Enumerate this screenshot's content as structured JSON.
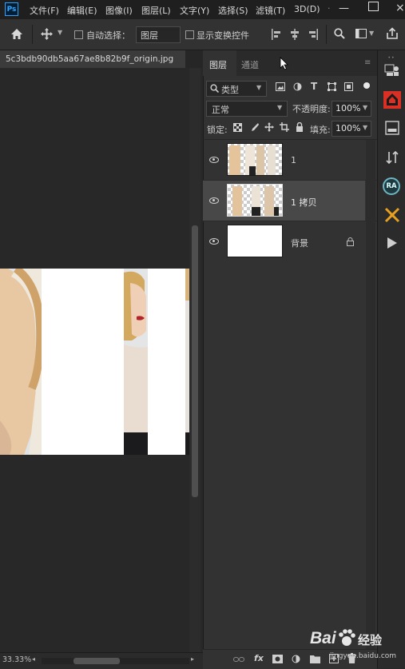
{
  "app_logo": "Ps",
  "menu": [
    "文件(F)",
    "编辑(E)",
    "图像(I)",
    "图层(L)",
    "文字(Y)",
    "选择(S)",
    "滤镜(T)",
    "3D(D)"
  ],
  "options": {
    "auto_select_label": "自动选择：",
    "auto_select_value": "图层",
    "show_transform_label": "显示变换控件"
  },
  "document": {
    "tab_title": "5c3bdb90db5aa67ae8b82b9f_origin.jpg",
    "zoom": "33.33%"
  },
  "layers_panel": {
    "tabs": [
      "图层",
      "通道"
    ],
    "filter_kind": "类型",
    "blend_mode": "正常",
    "opacity_label": "不透明度:",
    "opacity_value": "100%",
    "lock_label": "锁定:",
    "fill_label": "填充:",
    "fill_value": "100%",
    "layers": [
      {
        "name": "1",
        "visible": true,
        "selected": false,
        "locked": false
      },
      {
        "name": "1 拷贝",
        "visible": true,
        "selected": true,
        "locked": false
      },
      {
        "name": "背景",
        "visible": true,
        "selected": false,
        "locked": true
      }
    ],
    "footer_fx": "fx"
  },
  "right_panel": {
    "ra_label": "RA"
  },
  "watermark": {
    "brand": "Bai",
    "brand_tail": "经验",
    "url": "jingyan.baidu.com"
  }
}
